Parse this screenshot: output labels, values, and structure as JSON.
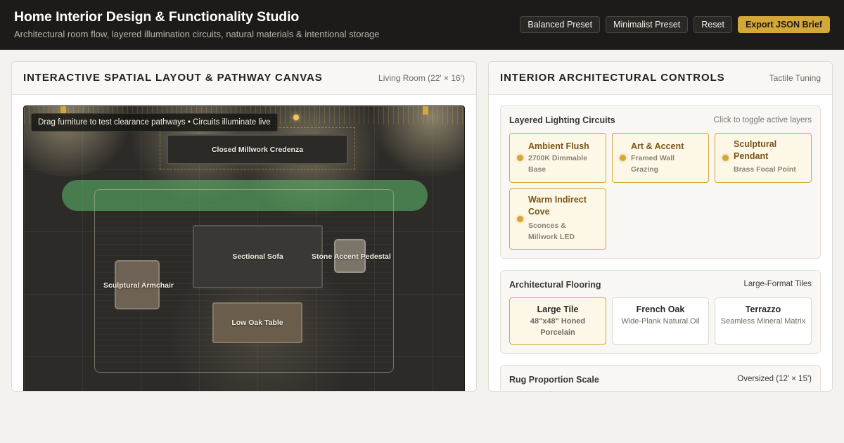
{
  "header": {
    "title": "Home Interior Design & Functionality Studio",
    "subtitle": "Architectural room flow, layered illumination circuits, natural materials & intentional storage",
    "buttons": {
      "balanced": "Balanced Preset",
      "minimalist": "Minimalist Preset",
      "reset": "Reset",
      "export": "Export JSON Brief"
    }
  },
  "canvas_panel": {
    "title": "INTERACTIVE SPATIAL LAYOUT & PATHWAY CANVAS",
    "room": "Living Room (22' × 16')",
    "tip": "Drag furniture to test clearance pathways • Circuits illuminate live",
    "furniture": {
      "credenza": "Closed Millwork Credenza",
      "sofa": "Sectional Sofa",
      "pedestal": "Stone Accent Pedestal",
      "armchair": "Sculptural Armchair",
      "table": "Low Oak Table"
    }
  },
  "controls_panel": {
    "title": "INTERIOR ARCHITECTURAL CONTROLS",
    "mode": "Tactile Tuning",
    "lighting": {
      "title": "Layered Lighting Circuits",
      "hint": "Click to toggle active layers",
      "circuits": [
        {
          "name": "Ambient Flush",
          "desc": "2700K Dimmable Base"
        },
        {
          "name": "Art & Accent",
          "desc": "Framed Wall Grazing"
        },
        {
          "name": "Sculptural Pendant",
          "desc": "Brass Focal Point"
        },
        {
          "name": "Warm Indirect Cove",
          "desc": "Sconces & Millwork LED"
        }
      ]
    },
    "flooring": {
      "title": "Architectural Flooring",
      "selected": "Large-Format Tiles",
      "options": [
        {
          "name": "Large Tile",
          "desc": "48\"x48\" Honed Porcelain"
        },
        {
          "name": "French Oak",
          "desc": "Wide-Plank Natural Oil"
        },
        {
          "name": "Terrazzo",
          "desc": "Seamless Mineral Matrix"
        }
      ]
    },
    "rug": {
      "title": "Rug Proportion Scale",
      "value": "Oversized (12' × 15')"
    }
  },
  "colors": {
    "accent": "#d4a73a",
    "header_bg": "#1c1b19",
    "pathway": "#5fbe6e"
  }
}
